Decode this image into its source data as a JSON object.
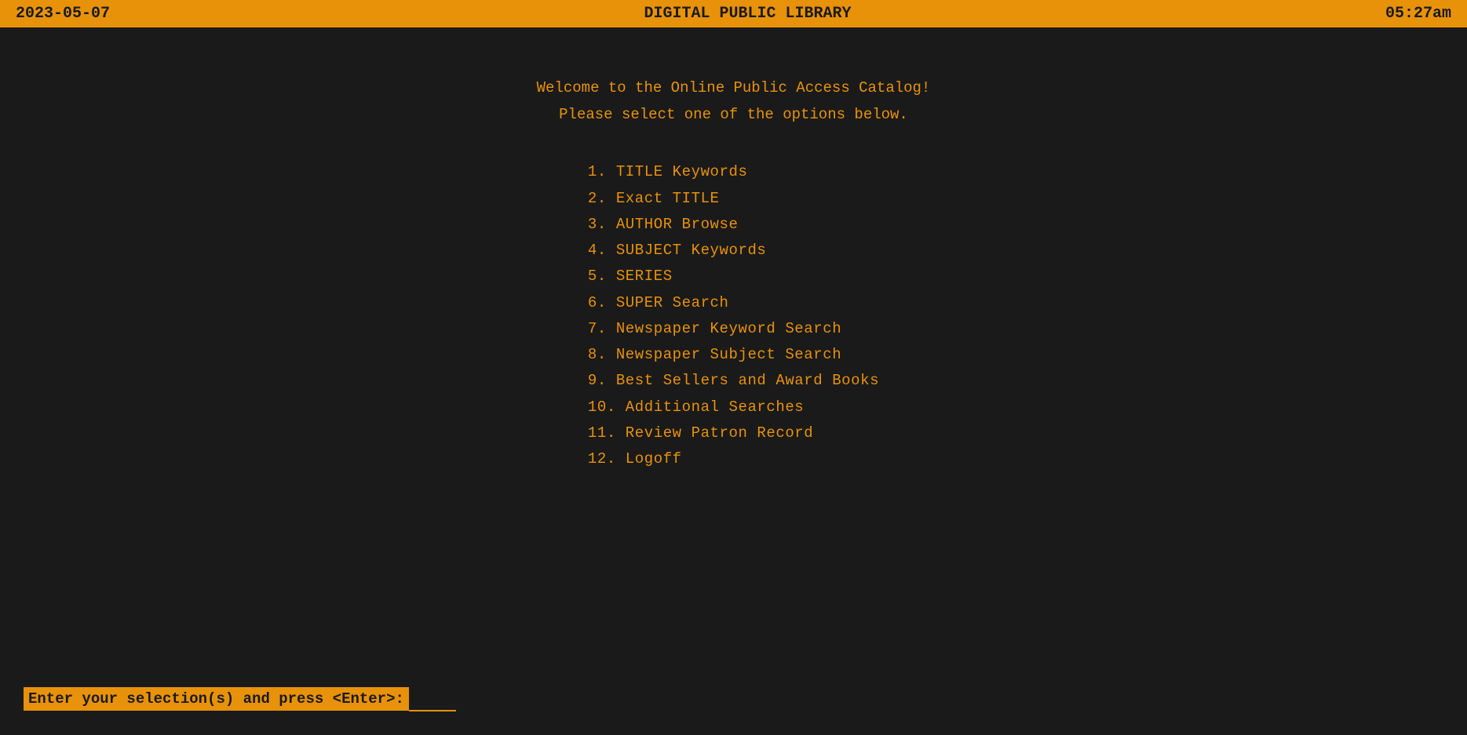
{
  "header": {
    "date": "2023-05-07",
    "title": "DIGITAL  PUBLIC  LIBRARY",
    "time": "05:27am"
  },
  "welcome": {
    "line1": "Welcome to the Online Public Access Catalog!",
    "line2": "Please select one of the options below."
  },
  "menu": {
    "items": [
      {
        "number": " 1.",
        "label": "TITLE Keywords"
      },
      {
        "number": " 2.",
        "label": "Exact TITLE"
      },
      {
        "number": " 3.",
        "label": "AUTHOR Browse"
      },
      {
        "number": " 4.",
        "label": "SUBJECT Keywords"
      },
      {
        "number": " 5.",
        "label": "SERIES"
      },
      {
        "number": " 6.",
        "label": "SUPER Search"
      },
      {
        "number": " 7.",
        "label": "Newspaper Keyword Search"
      },
      {
        "number": " 8.",
        "label": "Newspaper Subject Search"
      },
      {
        "number": " 9.",
        "label": "Best Sellers and Award Books"
      },
      {
        "number": "10.",
        "label": "Additional Searches"
      },
      {
        "number": "11.",
        "label": "Review Patron Record"
      },
      {
        "number": "12.",
        "label": "Logoff"
      }
    ]
  },
  "input_bar": {
    "label": "Enter your selection(s) and press <Enter>:",
    "placeholder": ""
  }
}
